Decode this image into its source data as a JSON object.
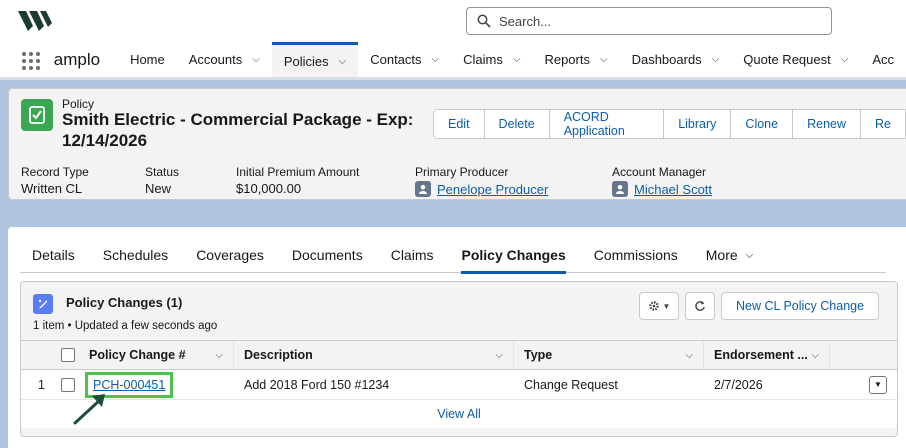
{
  "search": {
    "placeholder": "Search..."
  },
  "nav": {
    "app_name": "amplo",
    "items": [
      {
        "label": "Home",
        "has_menu": false
      },
      {
        "label": "Accounts",
        "has_menu": true
      },
      {
        "label": "Policies",
        "has_menu": true,
        "active": true
      },
      {
        "label": "Contacts",
        "has_menu": true
      },
      {
        "label": "Claims",
        "has_menu": true
      },
      {
        "label": "Reports",
        "has_menu": true
      },
      {
        "label": "Dashboards",
        "has_menu": true
      },
      {
        "label": "Quote Request",
        "has_menu": true
      },
      {
        "label": "Acc",
        "has_menu": false
      }
    ]
  },
  "record": {
    "object_label": "Policy",
    "title": "Smith Electric - Commercial Package - Exp: 12/14/2026",
    "actions": [
      "Edit",
      "Delete",
      "ACORD Application",
      "Library",
      "Clone",
      "Renew",
      "Re"
    ],
    "highlights": {
      "record_type": {
        "label": "Record Type",
        "value": "Written CL"
      },
      "status": {
        "label": "Status",
        "value": "New"
      },
      "premium": {
        "label": "Initial Premium Amount",
        "value": "$10,000.00"
      },
      "producer": {
        "label": "Primary Producer",
        "value": "Penelope Producer"
      },
      "manager": {
        "label": "Account Manager",
        "value": "Michael Scott"
      }
    }
  },
  "tabs": [
    "Details",
    "Schedules",
    "Coverages",
    "Documents",
    "Claims",
    "Policy Changes",
    "Commissions",
    "More"
  ],
  "active_tab": "Policy Changes",
  "related_list": {
    "title": "Policy Changes (1)",
    "subtitle": "1 item • Updated a few seconds ago",
    "new_button": "New CL Policy Change",
    "columns": [
      "Policy Change #",
      "Description",
      "Type",
      "Endorsement ..."
    ],
    "rows": [
      {
        "num": "1",
        "policy_change": "PCH-000451",
        "description": "Add 2018 Ford 150 #1234",
        "type": "Change Request",
        "endorsement": "2/7/2026"
      }
    ],
    "view_all": "View All"
  },
  "colors": {
    "accent": "#0b5cab",
    "highlight_box": "#4cc44a",
    "record_icon": "#3ba755",
    "related_icon": "#5a7df5",
    "annotation_arrow": "#1e4d3a"
  },
  "icons": [
    "logo",
    "search-icon",
    "app-launcher-icon",
    "policy-icon",
    "user-icon",
    "policy-change-icon",
    "gear-icon",
    "refresh-icon",
    "chevron-down-icon",
    "arrow-annotation"
  ]
}
